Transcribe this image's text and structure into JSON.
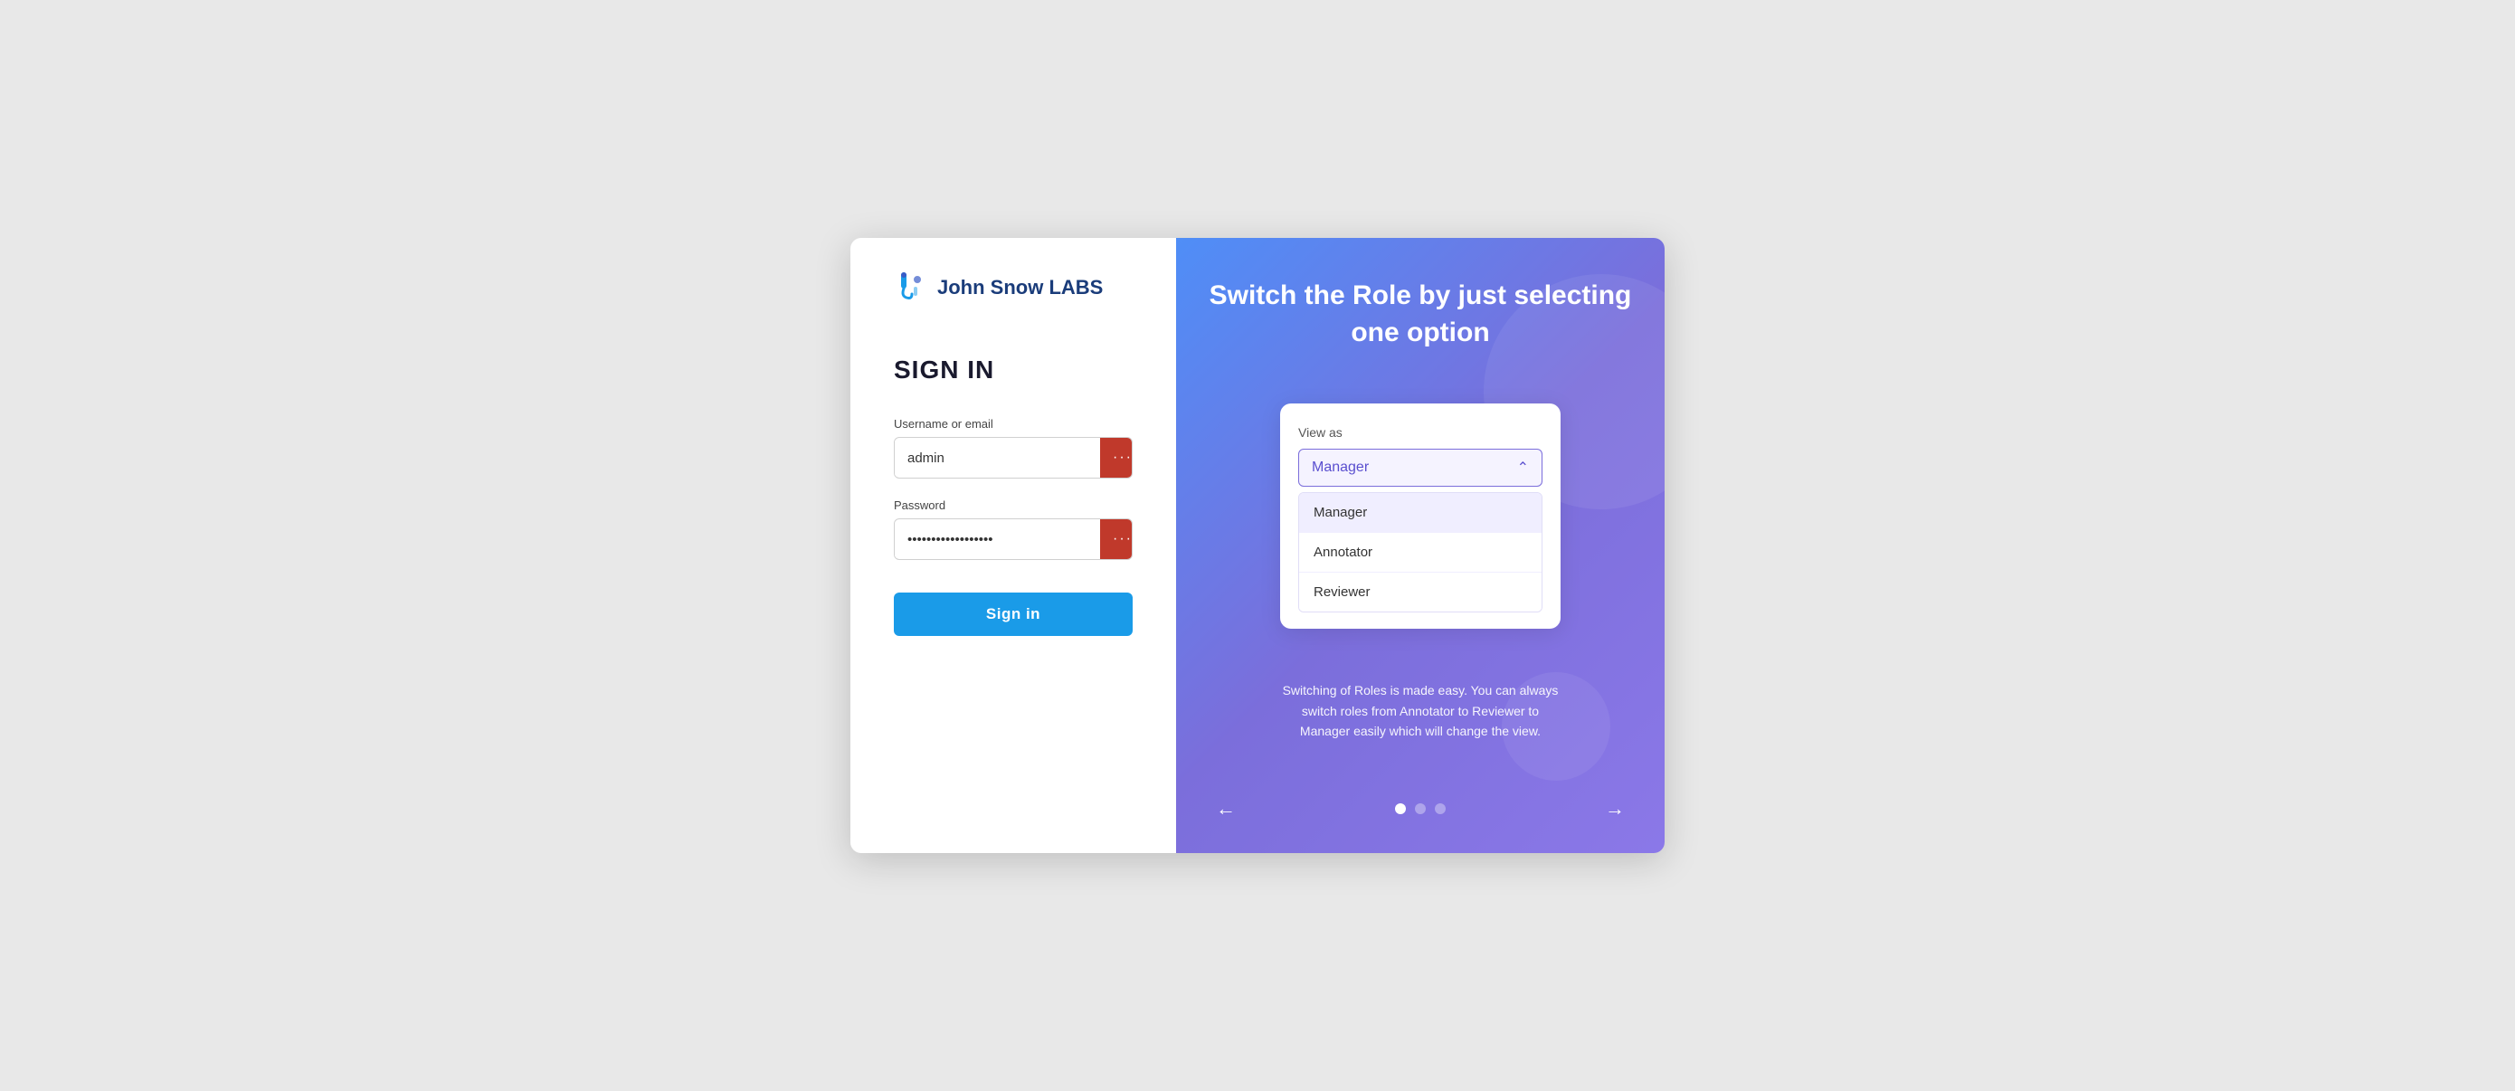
{
  "logo": {
    "text_normal": "John Snow ",
    "text_bold": "LABS",
    "icon_label": "jsl-logo"
  },
  "left": {
    "title": "SIGN IN",
    "username_label": "Username or email",
    "username_value": "admin",
    "username_placeholder": "Username or email",
    "password_label": "Password",
    "password_value": "••••••••••••••••••",
    "password_placeholder": "Password",
    "sign_in_button": "Sign in",
    "input_icon": "···"
  },
  "right": {
    "title": "Switch the Role by just selecting one option",
    "view_as_label": "View as",
    "selected_option": "Manager",
    "dropdown_options": [
      "Manager",
      "Annotator",
      "Reviewer"
    ],
    "subtitle": "Switching of Roles is made easy. You can always switch roles from Annotator to Reviewer to Manager easily which will change the view.",
    "prev_arrow": "←",
    "next_arrow": "→",
    "dots": [
      {
        "active": true
      },
      {
        "active": false
      },
      {
        "active": false
      }
    ]
  }
}
